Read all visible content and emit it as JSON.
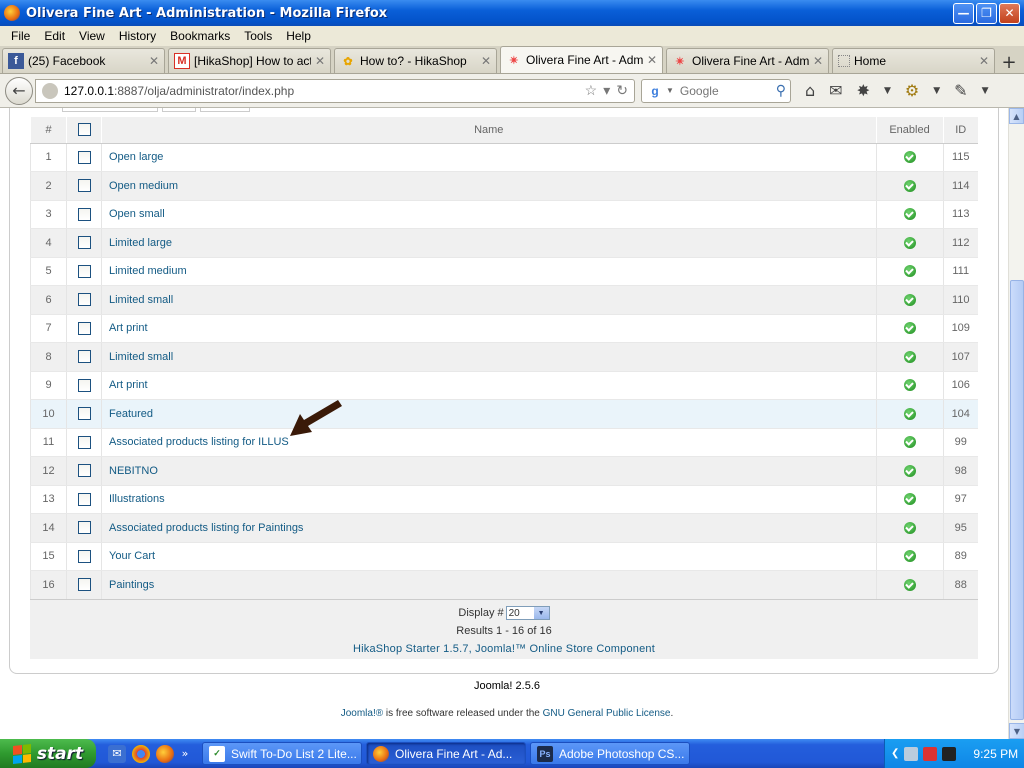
{
  "window": {
    "title": "Olivera Fine Art - Administration - Mozilla Firefox"
  },
  "menu": [
    "File",
    "Edit",
    "View",
    "History",
    "Bookmarks",
    "Tools",
    "Help"
  ],
  "tabs": [
    {
      "label": "(25) Facebook",
      "icon": "facebook-icon"
    },
    {
      "label": "[HikaShop] How to acti...",
      "icon": "gmail-icon"
    },
    {
      "label": "How to? - HikaShop",
      "icon": "hikashop-icon"
    },
    {
      "label": "Olivera Fine Art - Admin...",
      "icon": "joomla-icon"
    },
    {
      "label": "Olivera Fine Art - Admin...",
      "icon": "joomla-icon"
    },
    {
      "label": "Home",
      "icon": "blank-page-icon"
    }
  ],
  "nav": {
    "url_host": "127.0.0.1",
    "url_rest": ":8887/olja/administrator/index.php",
    "search_placeholder": "Google"
  },
  "table": {
    "headers": {
      "num": "#",
      "name": "Name",
      "enabled": "Enabled",
      "id": "ID"
    },
    "rows": [
      {
        "num": "1",
        "name": "Open large",
        "id": "115"
      },
      {
        "num": "2",
        "name": "Open medium",
        "id": "114"
      },
      {
        "num": "3",
        "name": "Open small",
        "id": "113"
      },
      {
        "num": "4",
        "name": "Limited large",
        "id": "112"
      },
      {
        "num": "5",
        "name": "Limited medium",
        "id": "111"
      },
      {
        "num": "6",
        "name": "Limited small",
        "id": "110"
      },
      {
        "num": "7",
        "name": "Art print",
        "id": "109"
      },
      {
        "num": "8",
        "name": "Limited small",
        "id": "107"
      },
      {
        "num": "9",
        "name": "Art print",
        "id": "106"
      },
      {
        "num": "10",
        "name": "Featured",
        "id": "104"
      },
      {
        "num": "11",
        "name": "Associated products listing for ILLUS",
        "id": "99"
      },
      {
        "num": "12",
        "name": "NEBITNO",
        "id": "98"
      },
      {
        "num": "13",
        "name": "Illustrations",
        "id": "97"
      },
      {
        "num": "14",
        "name": "Associated products listing for Paintings",
        "id": "95"
      },
      {
        "num": "15",
        "name": "Your Cart",
        "id": "89"
      },
      {
        "num": "16",
        "name": "Paintings",
        "id": "88"
      }
    ],
    "display_label": "Display #",
    "display_value": "20",
    "results": "Results 1 - 16 of 16",
    "credit": "HikaShop Starter 1.5.7, Joomla!™ Online Store Component"
  },
  "footer": {
    "version": "Joomla! 2.5.6",
    "license_link1": "Joomla!®",
    "license_mid": " is free software released under the ",
    "license_link2": "GNU General Public License",
    "license_end": "."
  },
  "taskbar": {
    "start": "start",
    "tasks": [
      {
        "label": "Swift To-Do List 2 Lite...",
        "icon": "todo-icon"
      },
      {
        "label": "Olivera Fine Art - Ad...",
        "icon": "firefox-icon"
      },
      {
        "label": "Adobe Photoshop CS...",
        "icon": "photoshop-icon"
      }
    ],
    "time": "9:25 PM"
  }
}
